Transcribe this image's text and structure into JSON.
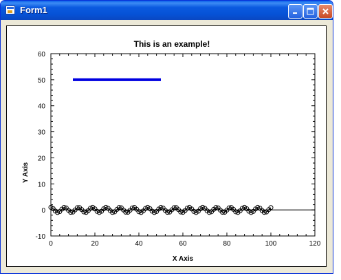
{
  "window": {
    "title": "Form1"
  },
  "title_buttons": {
    "minimize": "minimize-icon",
    "maximize": "maximize-icon",
    "close": "close-icon"
  },
  "colors": {
    "titlebar": "#0652d6",
    "line_series": "#0000e0",
    "markers": "#000000"
  },
  "chart_data": {
    "type": "line",
    "title": "This is an example!",
    "xlabel": "X Axis",
    "ylabel": "Y Axis",
    "xlim": [
      0,
      120
    ],
    "ylim": [
      -10,
      60
    ],
    "x_ticks": [
      0,
      20,
      40,
      60,
      80,
      100,
      120
    ],
    "y_ticks": [
      -10,
      0,
      10,
      20,
      30,
      40,
      50,
      60
    ],
    "grid": false,
    "series": [
      {
        "kind": "line",
        "color": "#0000e0",
        "x": [
          10,
          50
        ],
        "y": [
          50,
          50
        ]
      },
      {
        "kind": "sine-markers",
        "color": "#000000",
        "x_start": 0,
        "x_end": 100,
        "step": 1,
        "amplitude": 1,
        "period": 6.28
      },
      {
        "kind": "zero-line",
        "color": "#000000",
        "x": [
          0,
          120
        ],
        "y": [
          0,
          0
        ]
      }
    ]
  }
}
